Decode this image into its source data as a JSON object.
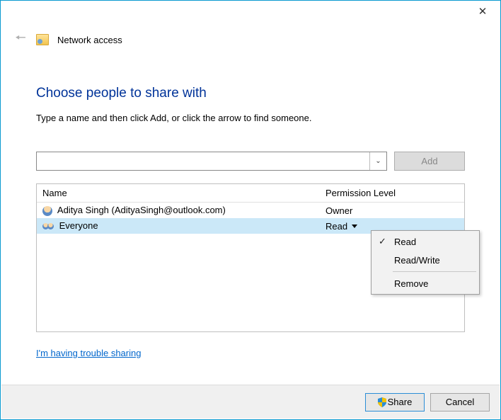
{
  "header": {
    "title": "Network access"
  },
  "main": {
    "heading": "Choose people to share with",
    "instruction": "Type a name and then click Add, or click the arrow to find someone.",
    "name_input_value": "",
    "add_button": "Add",
    "table": {
      "col_name": "Name",
      "col_perm": "Permission Level",
      "rows": [
        {
          "name": "Aditya Singh (AdityaSingh@outlook.com)",
          "perm": "Owner"
        },
        {
          "name": "Everyone",
          "perm": "Read"
        }
      ]
    },
    "help_link": "I'm having trouble sharing"
  },
  "dropdown": {
    "read": "Read",
    "readwrite": "Read/Write",
    "remove": "Remove"
  },
  "footer": {
    "share": "Share",
    "cancel": "Cancel"
  }
}
